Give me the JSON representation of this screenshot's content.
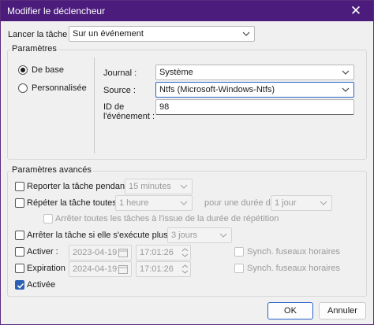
{
  "window": {
    "title": "Modifier le déclencheur",
    "close_glyph": "✕"
  },
  "trigger": {
    "label": "Lancer la tâche :",
    "value": "Sur un événement"
  },
  "params": {
    "title": "Paramètres",
    "radio_basic": "De base",
    "radio_custom": "Personnalisée",
    "log_label": "Journal :",
    "log_value": "Système",
    "source_label": "Source :",
    "source_value": "Ntfs (Microsoft-Windows-Ntfs)",
    "event_id_label_1": "ID de",
    "event_id_label_2": "l'événement :",
    "event_id_value": "98"
  },
  "advanced": {
    "title": "Paramètres avancés",
    "delay_label": "Reporter la tâche pendant :",
    "delay_value": "15 minutes",
    "repeat_label": "Répéter la tâche toutes les :",
    "repeat_value": "1 heure",
    "duration_label": "pour une durée de :",
    "duration_value": "1 jour",
    "stop_all_label": "Arrêter toutes les tâches à l'issue de la durée de répétition",
    "stop_if_label": "Arrêter la tâche si elle s'exécute plus de :",
    "stop_if_value": "3 jours",
    "activate_label": "Activer :",
    "activate_date": "2023-04-19",
    "activate_time": "17:01:26",
    "activate_sync": "Synch. fuseaux horaires",
    "expire_label": "Expiration :",
    "expire_date": "2024-04-19",
    "expire_time": "17:01:26",
    "expire_sync": "Synch. fuseaux horaires",
    "enabled_label": "Activée"
  },
  "buttons": {
    "ok": "OK",
    "cancel": "Annuler"
  },
  "colors": {
    "titlebar": "#4b1c7c",
    "accent": "#2b5fb4"
  }
}
